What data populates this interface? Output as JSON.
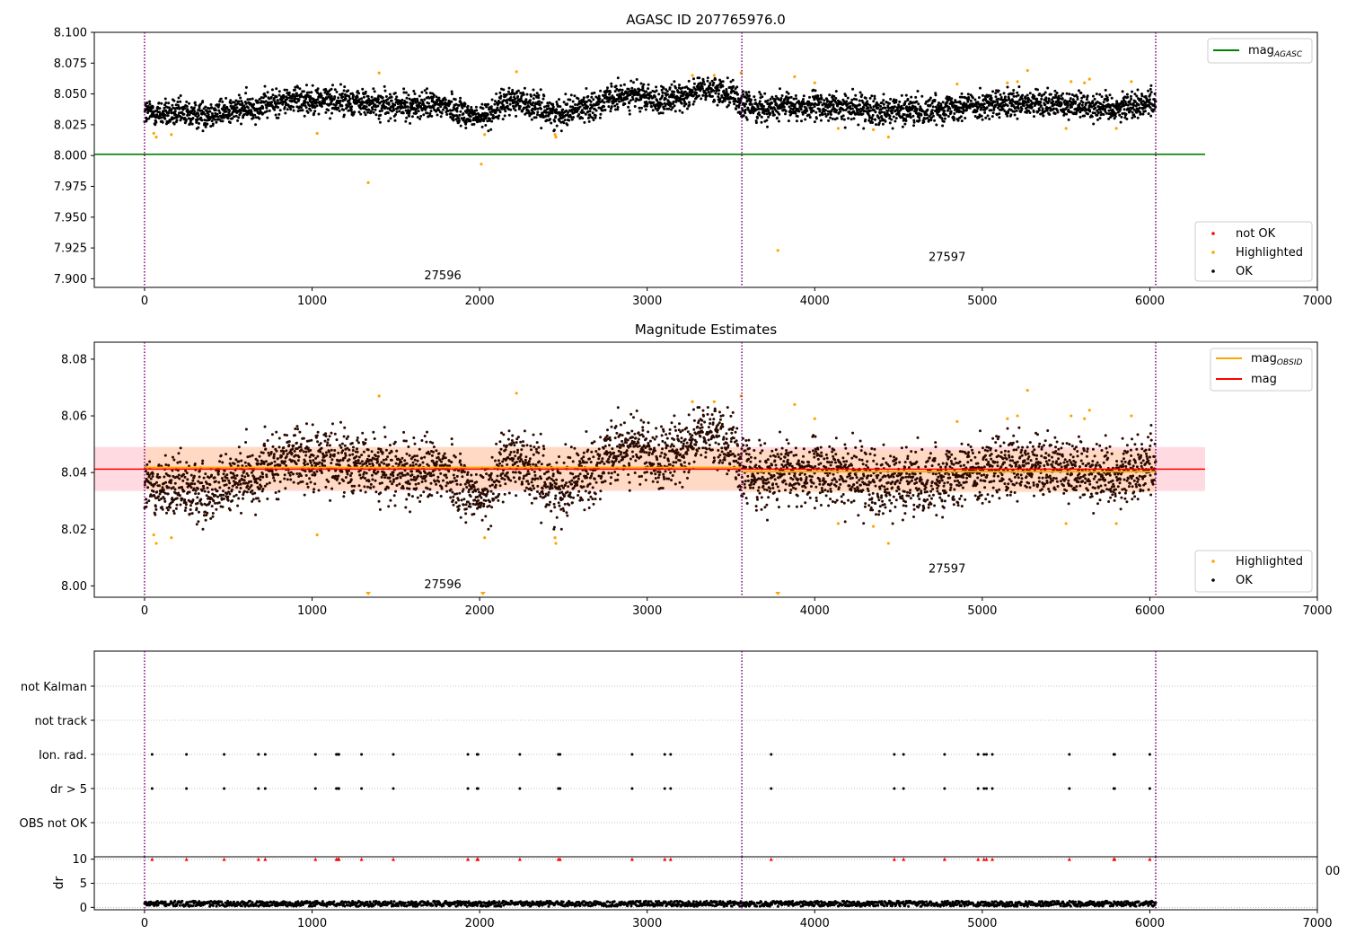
{
  "chart_data": [
    {
      "type": "scatter",
      "title": "AGASC ID 207765976.0",
      "xlim": [
        -300,
        7000
      ],
      "ylim": [
        7.893,
        8.1
      ],
      "xticks": [
        "0",
        "1000",
        "2000",
        "3000",
        "4000",
        "5000",
        "6000",
        "7000"
      ],
      "yticks": [
        "8.100",
        "8.075",
        "8.050",
        "8.025",
        "8.000",
        "7.975",
        "7.950",
        "7.925",
        "7.900"
      ],
      "obs_boundaries": [
        0,
        3565,
        6035
      ],
      "obsids": [
        {
          "label": "27596",
          "x": 1780,
          "y": 7.9025
        },
        {
          "label": "27597",
          "x": 4790,
          "y": 7.9175
        }
      ],
      "reference_line": {
        "name": "mag_AGASC",
        "y": 8.001,
        "x": [
          -300,
          6330
        ],
        "color": "#008000"
      },
      "legend_lines": [
        {
          "main": "mag",
          "sub": "AGASC",
          "color": "#008000"
        }
      ],
      "legend_points": [
        {
          "label": "not OK",
          "color": "#ff0000"
        },
        {
          "label": "Highlighted",
          "color": "#ffa500"
        },
        {
          "label": "OK",
          "color": "#000000"
        }
      ],
      "series": [
        {
          "name": "OK",
          "color": "#000000",
          "description": "~4000 points, mag 8.020–8.062 spanning x 0–6035",
          "x": [
            0,
            300,
            600,
            900,
            1200,
            1500,
            1800,
            2000,
            2200,
            2450,
            2700,
            2900,
            3100,
            3300,
            3500,
            3565,
            3700,
            4000,
            4300,
            4600,
            4900,
            5200,
            5500,
            5800,
            6035
          ],
          "y": [
            8.035,
            8.033,
            8.038,
            8.046,
            8.044,
            8.04,
            8.041,
            8.03,
            8.046,
            8.034,
            8.042,
            8.05,
            8.043,
            8.053,
            8.052,
            8.04,
            8.039,
            8.04,
            8.038,
            8.036,
            8.041,
            8.041,
            8.042,
            8.039,
            8.044
          ]
        },
        {
          "name": "Highlighted",
          "color": "#ffa500",
          "x": [
            55,
            70,
            160,
            1030,
            1335,
            1400,
            2010,
            2030,
            2220,
            2450,
            2455,
            3270,
            3400,
            3560,
            3780,
            3880,
            4000,
            4140,
            4350,
            4440,
            4850,
            5150,
            5210,
            5270,
            5500,
            5530,
            5610,
            5640,
            5800,
            5890
          ],
          "y": [
            8.018,
            8.015,
            8.017,
            8.018,
            7.978,
            8.067,
            7.993,
            8.017,
            8.068,
            8.017,
            8.015,
            8.065,
            8.065,
            8.067,
            7.923,
            8.064,
            8.059,
            8.022,
            8.021,
            8.015,
            8.058,
            8.059,
            8.06,
            8.069,
            8.022,
            8.06,
            8.059,
            8.062,
            8.022,
            8.06
          ]
        }
      ]
    },
    {
      "type": "scatter",
      "title": "Magnitude Estimates",
      "xlim": [
        -300,
        7000
      ],
      "ylim": [
        7.996,
        8.086
      ],
      "xticks": [
        "0",
        "1000",
        "2000",
        "3000",
        "4000",
        "5000",
        "6000",
        "7000"
      ],
      "yticks": [
        "8.08",
        "8.06",
        "8.04",
        "8.02",
        "8.00"
      ],
      "obs_boundaries": [
        0,
        3565,
        6035
      ],
      "obsids": [
        {
          "label": "27596",
          "x": 1780,
          "y": 8.0005
        },
        {
          "label": "27597",
          "x": 4790,
          "y": 8.006
        }
      ],
      "bands": [
        {
          "name": "mag",
          "x": [
            -300,
            6330
          ],
          "y": [
            8.0335,
            8.049
          ],
          "color": "#ffb6c1"
        },
        {
          "name": "mag_OBSID 27596",
          "x": [
            0,
            3565
          ],
          "y": [
            8.034,
            8.049
          ],
          "color": "#ffd8a8"
        },
        {
          "name": "mag_OBSID 27597",
          "x": [
            3565,
            6035
          ],
          "y": [
            8.033,
            8.048
          ],
          "color": "#ffd8a8"
        }
      ],
      "lines": [
        {
          "name": "mag",
          "color": "#ff0000",
          "x": [
            -300,
            6330
          ],
          "y": [
            8.0412,
            8.0412
          ]
        },
        {
          "name": "mag_OBSID",
          "color": "#ffa500",
          "segments": [
            {
              "x": [
                0,
                3565
              ],
              "y": 8.0418
            },
            {
              "x": [
                3565,
                6035
              ],
              "y": 8.0403
            }
          ]
        }
      ],
      "legend_lines": [
        {
          "main": "mag",
          "sub": "OBSID",
          "color": "#ffa500"
        },
        {
          "main": "mag",
          "sub": "",
          "color": "#ff0000"
        }
      ],
      "legend_points": [
        {
          "label": "Highlighted",
          "color": "#ffa500"
        },
        {
          "label": "OK",
          "color": "#000000"
        }
      ],
      "offscale_markers": [
        1335,
        2020,
        3780
      ]
    },
    {
      "type": "scatter",
      "xlim": [
        -300,
        7000
      ],
      "categories": [
        "not Kalman",
        "not track",
        "Ion. rad.",
        "dr > 5",
        "OBS not OK"
      ],
      "obs_boundaries": [
        0,
        3565,
        6035
      ],
      "flag_times": [
        45,
        250,
        475,
        680,
        720,
        1020,
        1145,
        1155,
        1160,
        1295,
        1485,
        1930,
        1985,
        1990,
        2240,
        2470,
        2480,
        2910,
        3105,
        3140,
        3740,
        4475,
        4530,
        4775,
        4975,
        5010,
        5025,
        5060,
        5520,
        5785,
        5790,
        6000
      ],
      "flags": {
        "Ion. rad.": "flag_times",
        "dr > 5": "flag_times"
      }
    },
    {
      "type": "scatter",
      "ylabel": "dr",
      "xlim": [
        -300,
        7000
      ],
      "ylim": [
        -0.5,
        10.5
      ],
      "xticks": [
        "0",
        "1000",
        "2000",
        "3000",
        "4000",
        "5000",
        "6000",
        "7000"
      ],
      "yticks": [
        "10",
        "5",
        "0"
      ],
      "obs_boundaries": [
        0,
        3565,
        6035
      ],
      "clipped_at": 10,
      "clipped_times": [
        45,
        250,
        475,
        680,
        720,
        1020,
        1145,
        1155,
        1160,
        1295,
        1485,
        1930,
        1985,
        1990,
        2240,
        2470,
        2480,
        2910,
        3105,
        3140,
        3740,
        4475,
        4530,
        4775,
        4975,
        5010,
        5025,
        5060,
        5520,
        5785,
        5790,
        6000
      ],
      "typical_dr": [
        0.2,
        1.3
      ],
      "overflow_tick_fragment": "00"
    }
  ],
  "colors": {
    "ok": "#000000",
    "highlighted": "#ffa500",
    "not_ok": "#ff0000",
    "boundary": "#800080",
    "grid": "#b0b0b0"
  }
}
